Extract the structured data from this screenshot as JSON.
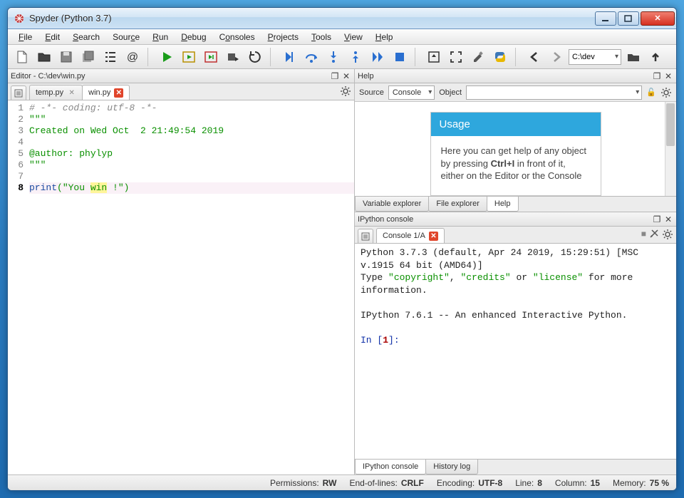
{
  "window": {
    "title": "Spyder (Python 3.7)"
  },
  "menu": [
    "File",
    "Edit",
    "Search",
    "Source",
    "Run",
    "Debug",
    "Consoles",
    "Projects",
    "Tools",
    "View",
    "Help"
  ],
  "toolbar": {
    "workdir": "C:\\dev"
  },
  "editor": {
    "pane_title": "Editor - C:\\dev\\win.py",
    "tabs": [
      {
        "label": "temp.py",
        "active": false,
        "dirty": false
      },
      {
        "label": "win.py",
        "active": true,
        "dirty": true
      }
    ],
    "code": {
      "lines": [
        {
          "n": 1,
          "kind": "comment",
          "text": "# -*- coding: utf-8 -*-"
        },
        {
          "n": 2,
          "kind": "docstr",
          "text": "\"\"\""
        },
        {
          "n": 3,
          "kind": "docstr",
          "text": "Created on Wed Oct  2 21:49:54 2019"
        },
        {
          "n": 4,
          "kind": "blank",
          "text": ""
        },
        {
          "n": 5,
          "kind": "docstr",
          "text": "@author: phylyp"
        },
        {
          "n": 6,
          "kind": "docstr",
          "text": "\"\"\""
        },
        {
          "n": 7,
          "kind": "blank",
          "text": ""
        },
        {
          "n": 8,
          "kind": "code",
          "print_kw": "print",
          "str_open": "(\"You ",
          "cursor_word": "win",
          "str_close": " !\")",
          "current": true
        }
      ]
    }
  },
  "help": {
    "pane_title": "Help",
    "source_label": "Source",
    "source_value": "Console",
    "object_label": "Object",
    "object_value": "",
    "usage_title": "Usage",
    "usage_body_1": "Here you can get help of any object by pressing ",
    "usage_kbd": "Ctrl+I",
    "usage_body_2": " in front of it, either on the Editor or the Console",
    "bottom_tabs": [
      "Variable explorer",
      "File explorer",
      "Help"
    ],
    "bottom_active": 2
  },
  "ipython": {
    "pane_title": "IPython console",
    "tab_label": "Console 1/A",
    "text_line1": "Python 3.7.3 (default, Apr 24 2019, 15:29:51) [MSC v.1915 64 bit (AMD64)]",
    "text_line2a": "Type ",
    "text_kw1": "\"copyright\"",
    "text_sep1": ", ",
    "text_kw2": "\"credits\"",
    "text_sep2": " or ",
    "text_kw3": "\"license\"",
    "text_line2b": " for more information.",
    "text_line3": "IPython 7.6.1 -- An enhanced Interactive Python.",
    "prompt_in": "In [",
    "prompt_num": "1",
    "prompt_close": "]:",
    "bottom_tabs": [
      "IPython console",
      "History log"
    ],
    "bottom_active": 0
  },
  "status": {
    "perm_label": "Permissions:",
    "perm_value": "RW",
    "eol_label": "End-of-lines:",
    "eol_value": "CRLF",
    "enc_label": "Encoding:",
    "enc_value": "UTF-8",
    "line_label": "Line:",
    "line_value": "8",
    "col_label": "Column:",
    "col_value": "15",
    "mem_label": "Memory:",
    "mem_value": "75 %"
  }
}
